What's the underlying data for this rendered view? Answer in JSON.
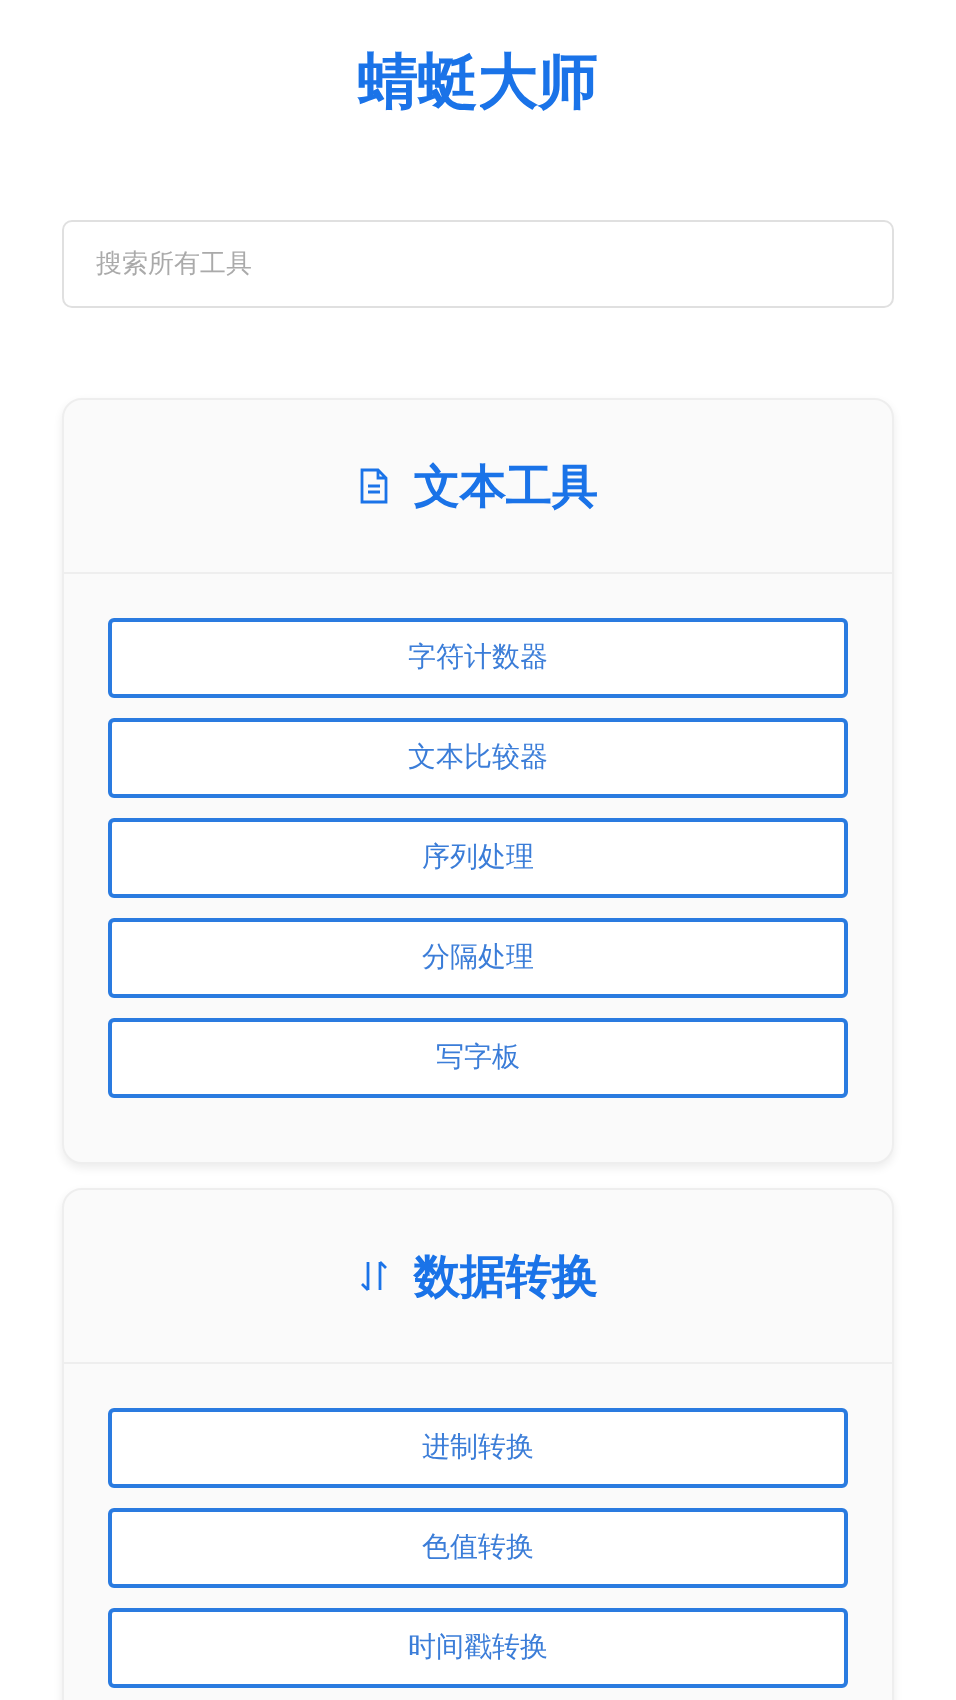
{
  "title": "蜻蜓大师",
  "search": {
    "placeholder": "搜索所有工具"
  },
  "sections": [
    {
      "title": "文本工具",
      "kind": "document",
      "tools": [
        "字符计数器",
        "文本比较器",
        "序列处理",
        "分隔处理",
        "写字板"
      ]
    },
    {
      "title": "数据转换",
      "kind": "swap",
      "tools": [
        "进制转换",
        "色值转换",
        "时间戳转换"
      ]
    }
  ]
}
